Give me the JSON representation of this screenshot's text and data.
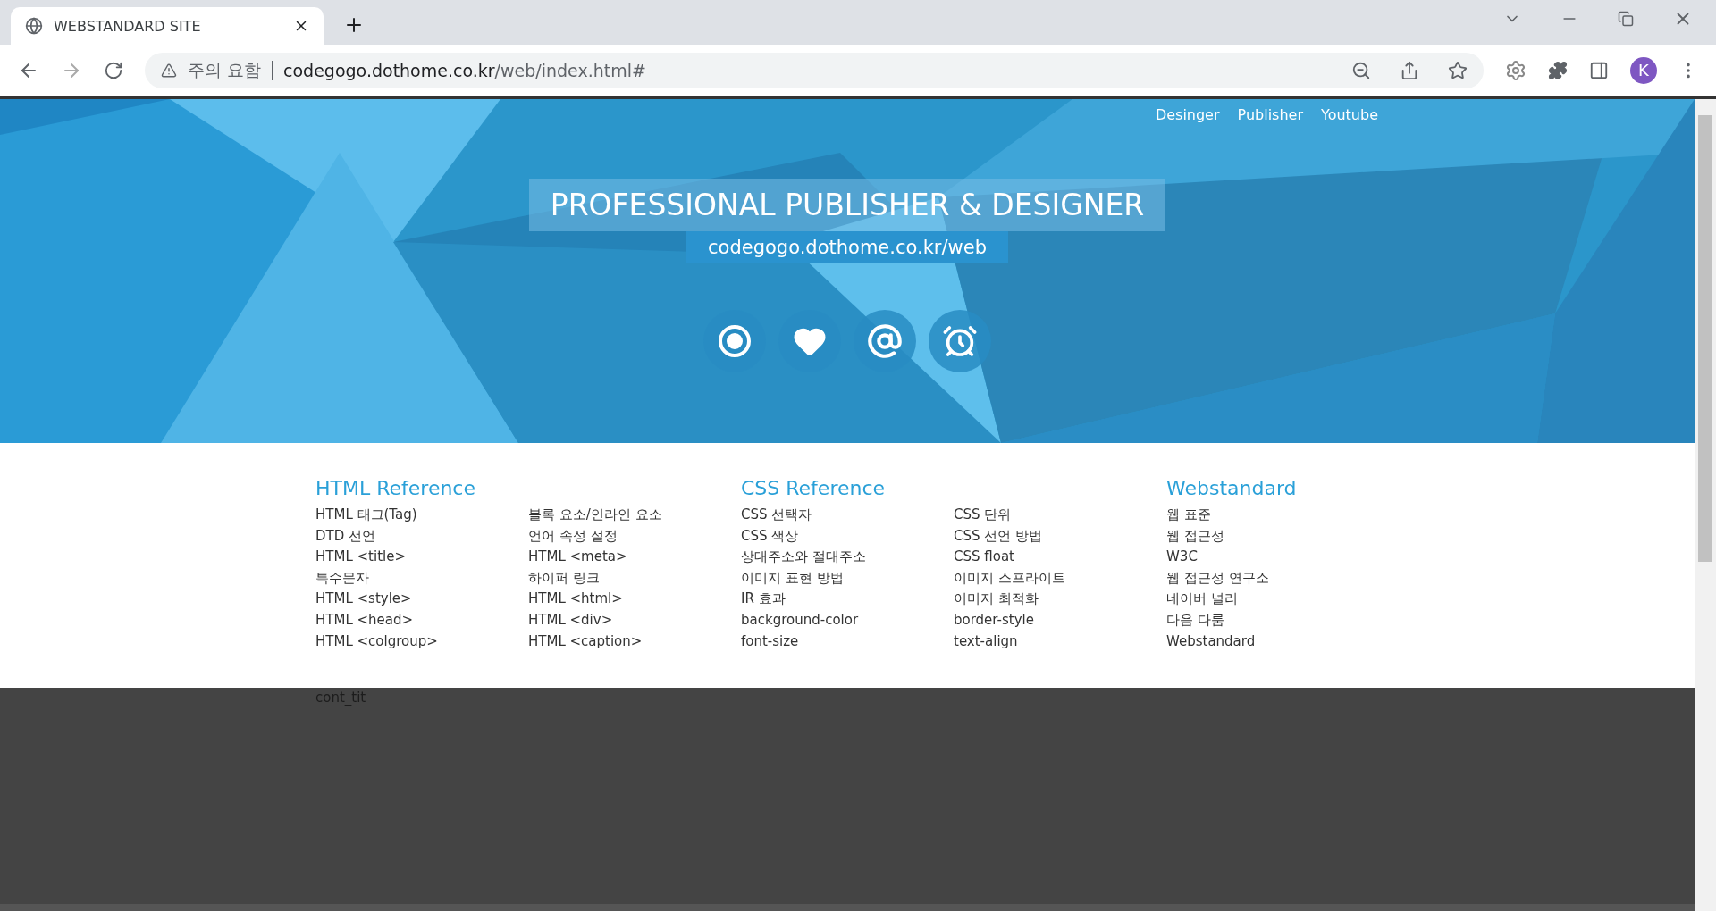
{
  "browser": {
    "tab": {
      "title": "WEBSTANDARD SITE",
      "selected": true
    },
    "address": {
      "warning": "주의 요함",
      "host": "codegogo.dothome.co.kr",
      "path": "/web/index.html#"
    },
    "profile": "K"
  },
  "hero": {
    "nav": [
      "Desinger",
      "Publisher",
      "Youtube"
    ],
    "title": "PROFESSIONAL PUBLISHER & DESIGNER",
    "subtitle": "codegogo.dothome.co.kr/web",
    "icons": [
      {
        "kind": "record"
      },
      {
        "kind": "heart"
      },
      {
        "kind": "at"
      },
      {
        "kind": "alarm"
      }
    ]
  },
  "references": [
    {
      "title": "HTML Reference",
      "columns": [
        [
          "HTML 태그(Tag)",
          "DTD 선언",
          "HTML <title>",
          "특수문자",
          "HTML <style>",
          "HTML <head>",
          "HTML <colgroup>"
        ],
        [
          "블록 요소/인라인 요소",
          "언어 속성 설정",
          "HTML <meta>",
          "하이퍼 링크",
          "HTML <html>",
          "HTML <div>",
          "HTML <caption>"
        ]
      ]
    },
    {
      "title": "CSS Reference",
      "columns": [
        [
          "CSS 선택자",
          "CSS 색상",
          "상대주소와 절대주소",
          "이미지 표현 방법",
          "IR 효과",
          "background-color",
          "font-size"
        ],
        [
          "CSS 단위",
          "CSS 선언 방법",
          "CSS float",
          "이미지 스프라이트",
          "이미지 최적화",
          "border-style",
          "text-align"
        ]
      ]
    },
    {
      "title": "Webstandard",
      "columns": [
        [
          "웹 표준",
          "웹 접근성",
          "W3C",
          "웹 접근성 연구소",
          "네이버 널리",
          "다음 다룸",
          "Webstandard"
        ]
      ]
    }
  ],
  "content": {
    "title": "cont_tit"
  }
}
